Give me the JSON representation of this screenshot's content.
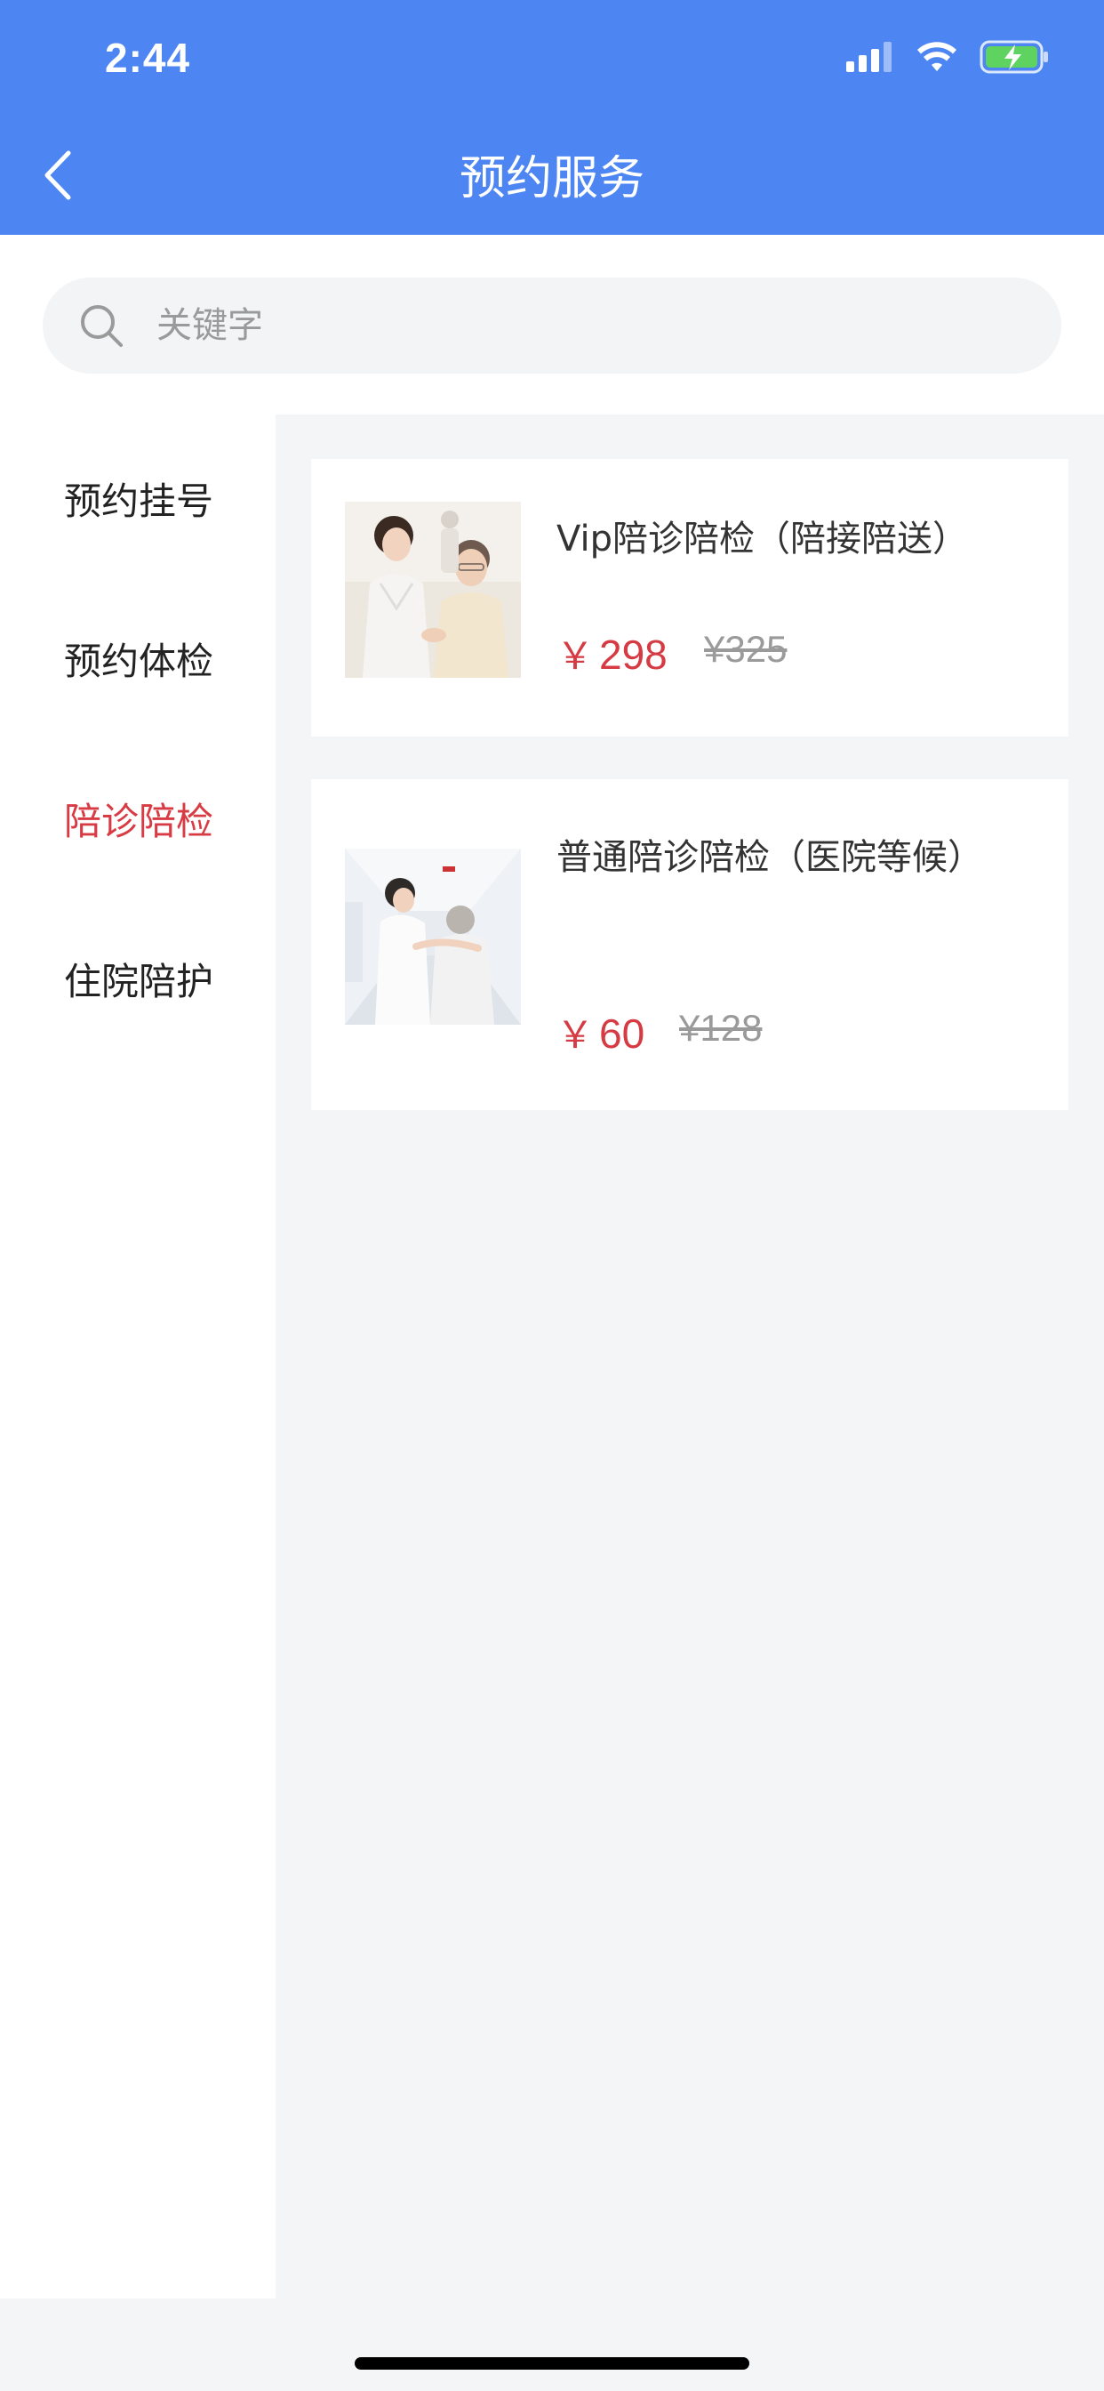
{
  "status_bar": {
    "time": "2:44"
  },
  "header": {
    "title": "预约服务"
  },
  "search": {
    "placeholder": "关键字"
  },
  "sidebar": {
    "items": [
      {
        "label": "预约挂号",
        "active": false
      },
      {
        "label": "预约体检",
        "active": false
      },
      {
        "label": "陪诊陪检",
        "active": true
      },
      {
        "label": "住院陪护",
        "active": false
      }
    ]
  },
  "services": [
    {
      "title": "Vip陪诊陪检（陪接陪送）",
      "currency": "￥",
      "price": "298",
      "original_price": "¥325"
    },
    {
      "title": "普通陪诊陪检（医院等候）",
      "currency": "￥",
      "price": "60",
      "original_price": "¥128"
    }
  ],
  "colors": {
    "header_bg": "#4d86f2",
    "active_text": "#d83b43",
    "price_red": "#d63a43",
    "page_bg": "#f4f5f7"
  }
}
